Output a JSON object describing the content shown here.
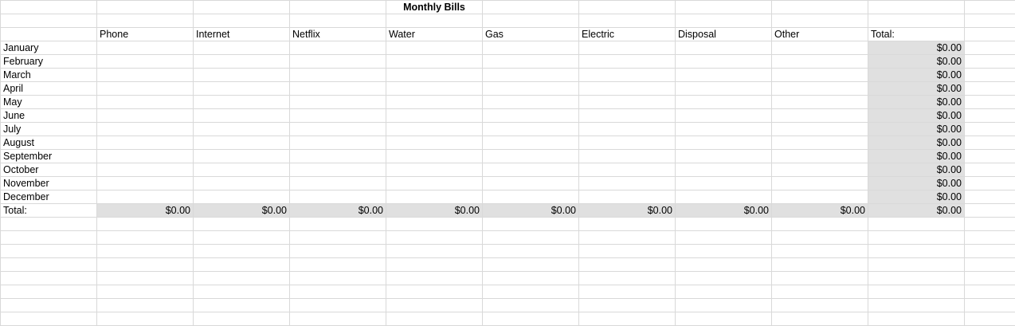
{
  "title": "Monthly Bills",
  "categories": [
    "Phone",
    "Internet",
    "Netflix",
    "Water",
    "Gas",
    "Electric",
    "Disposal",
    "Other"
  ],
  "total_header": "Total:",
  "months": [
    "January",
    "February",
    "March",
    "April",
    "May",
    "June",
    "July",
    "August",
    "September",
    "October",
    "November",
    "December"
  ],
  "month_totals": [
    "$0.00",
    "$0.00",
    "$0.00",
    "$0.00",
    "$0.00",
    "$0.00",
    "$0.00",
    "$0.00",
    "$0.00",
    "$0.00",
    "$0.00",
    "$0.00"
  ],
  "total_row_label": "Total:",
  "category_totals": [
    "$0.00",
    "$0.00",
    "$0.00",
    "$0.00",
    "$0.00",
    "$0.00",
    "$0.00",
    "$0.00"
  ],
  "grand_total": "$0.00",
  "colors": {
    "gridline": "#d9d9d9",
    "total_fill": "#e0e0e0",
    "border": "#000000"
  }
}
